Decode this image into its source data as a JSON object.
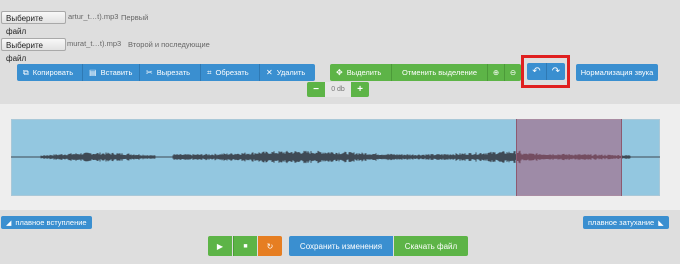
{
  "files": [
    {
      "button": "Выберите файл",
      "filename": "artur_t…t).mp3",
      "label": "Первый"
    },
    {
      "button": "Выберите файл",
      "filename": "murat_t…t).mp3",
      "label": "Второй и последующие"
    }
  ],
  "toolbar": {
    "copy": "Копировать",
    "paste": "Вставить",
    "cut": "Вырезать",
    "crop": "Обрезать",
    "delete": "Удалить",
    "select": "Выделить",
    "deselect": "Отменить выделение",
    "normalize": "Нормализация звука"
  },
  "volume": {
    "minus": "−",
    "value": "0 db",
    "plus": "+"
  },
  "fades": {
    "in": "плавное вступление",
    "out": "плавное затухание"
  },
  "playback": {
    "save": "Сохранить изменения",
    "download": "Скачать файл"
  },
  "colors": {
    "blue": "#3a8fd0",
    "green": "#5db447",
    "orange": "#e67e22",
    "highlight": "#e02020",
    "waveform": "#3f4a55"
  },
  "icons": [
    "copy-icon",
    "paste-icon",
    "cut-icon",
    "crop-icon",
    "delete-icon",
    "select-icon",
    "zoom-in-icon",
    "zoom-out-icon",
    "undo-icon",
    "redo-icon",
    "play-icon",
    "stop-icon",
    "loop-icon",
    "fade-in-icon",
    "fade-out-icon"
  ]
}
